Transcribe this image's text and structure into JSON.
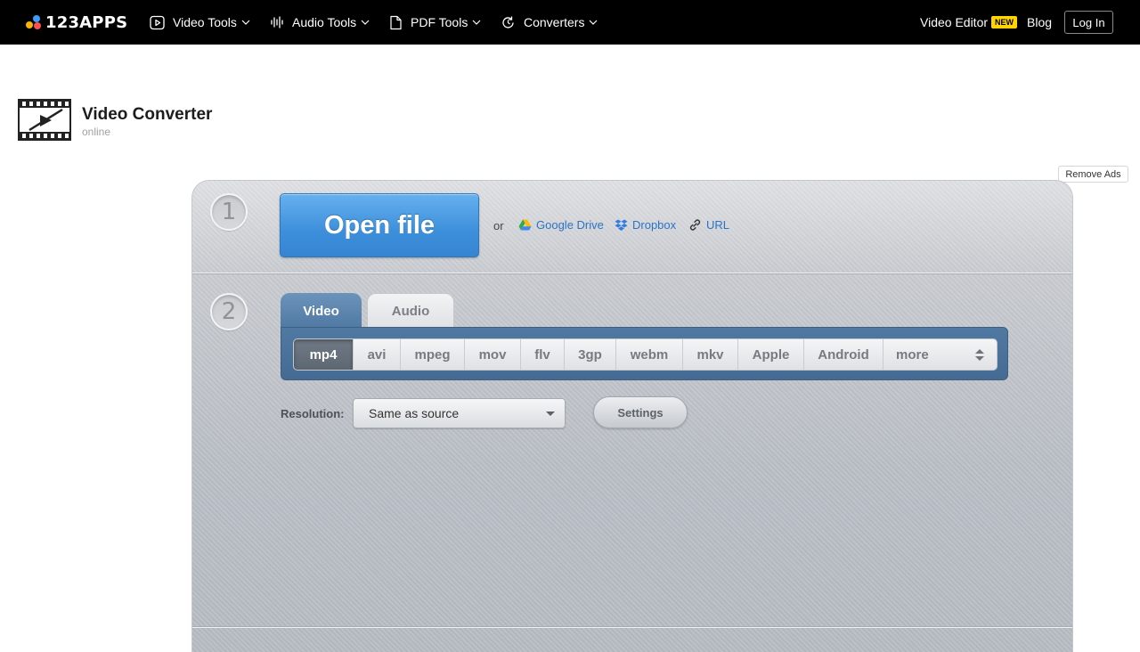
{
  "nav": {
    "logo": "123APPS",
    "menus": [
      {
        "label": "Video Tools",
        "icon": "play-circle-icon"
      },
      {
        "label": "Audio Tools",
        "icon": "waveform-icon"
      },
      {
        "label": "PDF Tools",
        "icon": "document-icon"
      },
      {
        "label": "Converters",
        "icon": "refresh-icon"
      }
    ],
    "video_editor": "Video Editor",
    "new_badge": "NEW",
    "blog": "Blog",
    "login": "Log In"
  },
  "header": {
    "title": "Video Converter",
    "subtitle": "online",
    "remove_ads": "Remove Ads"
  },
  "step1": {
    "number": "1",
    "open_file": "Open file",
    "or": "or",
    "sources": [
      "Google Drive",
      "Dropbox",
      "URL"
    ]
  },
  "step2": {
    "number": "2",
    "tabs": [
      "Video",
      "Audio"
    ],
    "active_tab": "Video",
    "formats": [
      "mp4",
      "avi",
      "mpeg",
      "mov",
      "flv",
      "3gp",
      "webm",
      "mkv",
      "Apple",
      "Android",
      "more"
    ],
    "active_format": "mp4",
    "resolution_label": "Resolution:",
    "resolution_value": "Same as source",
    "settings": "Settings"
  },
  "colors": {
    "accent_blue": "#3d8fdb",
    "tab_blue": "#4f79a3",
    "link_blue": "#2b73c5",
    "new_badge_yellow": "#ffd400"
  }
}
